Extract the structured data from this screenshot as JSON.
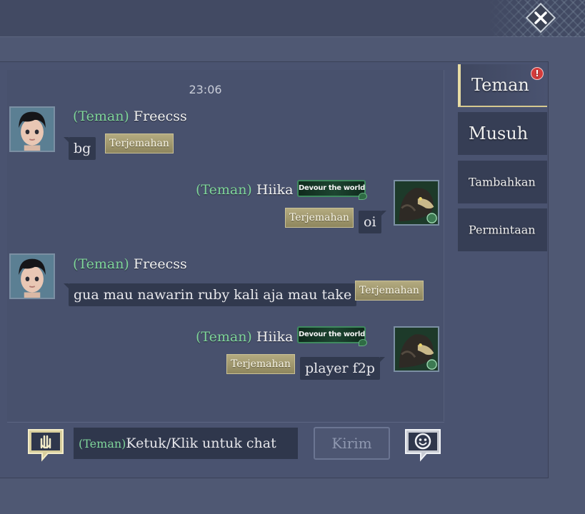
{
  "window": {
    "close_icon": "close-x-icon"
  },
  "chat": {
    "timestamp": "23:06",
    "translate_label": "Terjemahan",
    "messages": [
      {
        "side": "left",
        "tag": "(Teman)",
        "name": "Freecss",
        "text": "bg",
        "avatar_icon": "boy-avatar-icon"
      },
      {
        "side": "right",
        "tag": "(Teman)",
        "name": "Hiika",
        "title_badge": "Devour the world",
        "text": "oi",
        "avatar_icon": "eagle-avatar-icon"
      },
      {
        "side": "left",
        "tag": "(Teman)",
        "name": "Freecss",
        "text": "gua mau nawarin ruby kali aja mau take",
        "avatar_icon": "boy-avatar-icon"
      },
      {
        "side": "right",
        "tag": "(Teman)",
        "name": "Hiika",
        "title_badge": "Devour the world",
        "text": "player f2p",
        "avatar_icon": "eagle-avatar-icon"
      }
    ]
  },
  "sidebar": {
    "tabs": [
      {
        "label": "Teman",
        "active": true,
        "alert": "!"
      },
      {
        "label": "Musuh",
        "active": false
      },
      {
        "label": "Tambahkan",
        "active": false
      },
      {
        "label": "Permintaan",
        "active": false
      }
    ]
  },
  "input_bar": {
    "channel_tag": "(Teman)",
    "placeholder": "Ketuk/Klik untuk chat",
    "send_label": "Kirim",
    "voice_icon": "voice-hand-icon",
    "emoji_icon": "emoji-face-icon"
  },
  "colors": {
    "background": "#4f5873",
    "bubble": "#31394e",
    "friend_tag": "#7fd59a",
    "translate_button": "#a39a70",
    "active_tab_accent": "#e7dba4",
    "alert": "#d43b3b"
  }
}
